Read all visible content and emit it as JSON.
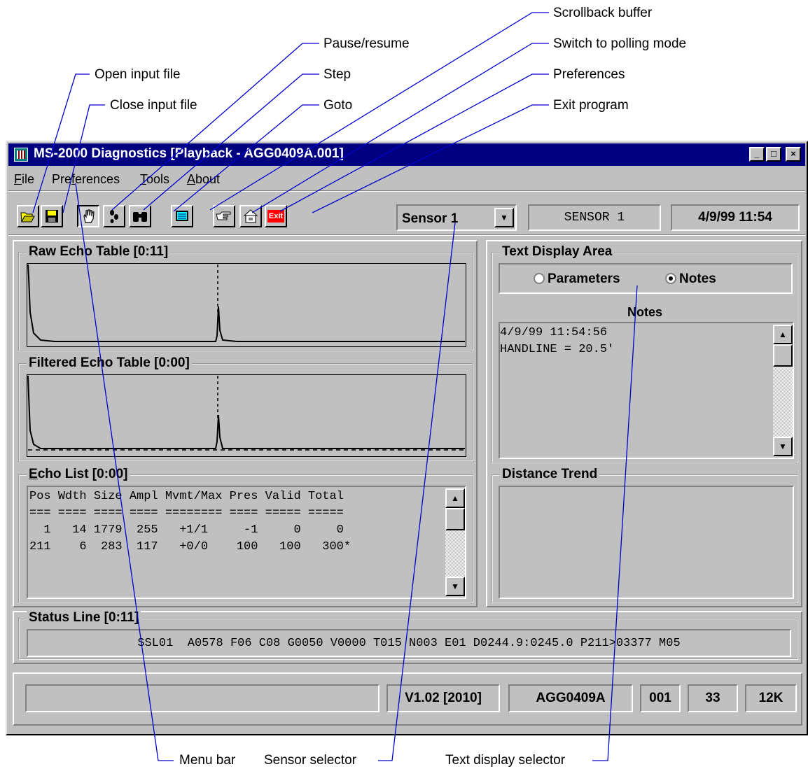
{
  "callouts": {
    "open_input_file": "Open input file",
    "close_input_file": "Close input file",
    "pause_resume": "Pause/resume",
    "step": "Step",
    "goto": "Goto",
    "scrollback_buffer": "Scrollback buffer",
    "switch_polling": "Switch to polling mode",
    "preferences": "Preferences",
    "exit_program": "Exit program",
    "menu_bar": "Menu bar",
    "sensor_selector": "Sensor selector",
    "text_display_selector": "Text display selector"
  },
  "window": {
    "title": "MS-2000 Diagnostics [Playback - AGG0409A.001]",
    "controls": [
      "_",
      "□",
      "×"
    ]
  },
  "menu": {
    "file": {
      "accel": "F",
      "rest": "ile"
    },
    "preferences": {
      "pre": "Pre",
      "accel": "f",
      "rest": "erences"
    },
    "tools": {
      "accel": "T",
      "rest": "ools"
    },
    "about": {
      "accel": "A",
      "rest": "bout"
    }
  },
  "toolbar": {
    "icons": [
      "open-folder-icon",
      "save-disk-icon",
      "hand-icon",
      "footsteps-icon",
      "binoculars-icon",
      "screen-icon",
      "pointing-hand-icon",
      "preferences-icon",
      "exit-icon"
    ],
    "exit_label": "Exit",
    "sensor_select": "Sensor 1",
    "sensor_name": "SENSOR 1",
    "datetime": "4/9/99 11:54"
  },
  "raw_echo": {
    "title": "Raw Echo Table [0:11]"
  },
  "filtered_echo": {
    "title": "Filtered Echo Table [0:00]"
  },
  "echo_list": {
    "title_accel": "E",
    "title_rest": "cho List [0:00]",
    "header": "Pos Wdth Size Ampl Mvmt/Max Pres Valid Total",
    "divider": "=== ==== ==== ==== ======== ==== ===== =====",
    "rows": [
      "  1   14 1779  255   +1/1     -1     0     0",
      "211    6  283  117   +0/0    100   100   300*"
    ]
  },
  "text_display": {
    "title": "Text Display Area",
    "option_parameters": "Parameters",
    "option_notes": "Notes",
    "selected": "Notes",
    "notes_label": "Notes",
    "notes_lines": [
      "4/9/99 11:54:56",
      "HANDLINE = 20.5'"
    ]
  },
  "distance_trend": {
    "title": "Distance Trend"
  },
  "status_line": {
    "title": "Status Line [0:11]",
    "text": "SSL01  A0578 F06 C08 G0050 V0000 T015 N003 E01 D0244.9:0245.0 P211>03377 M05"
  },
  "status_bar": {
    "left": "",
    "version": "V1.02 [2010]",
    "file": "AGG0409A",
    "ext": "001",
    "count": "33",
    "size": "12K"
  }
}
